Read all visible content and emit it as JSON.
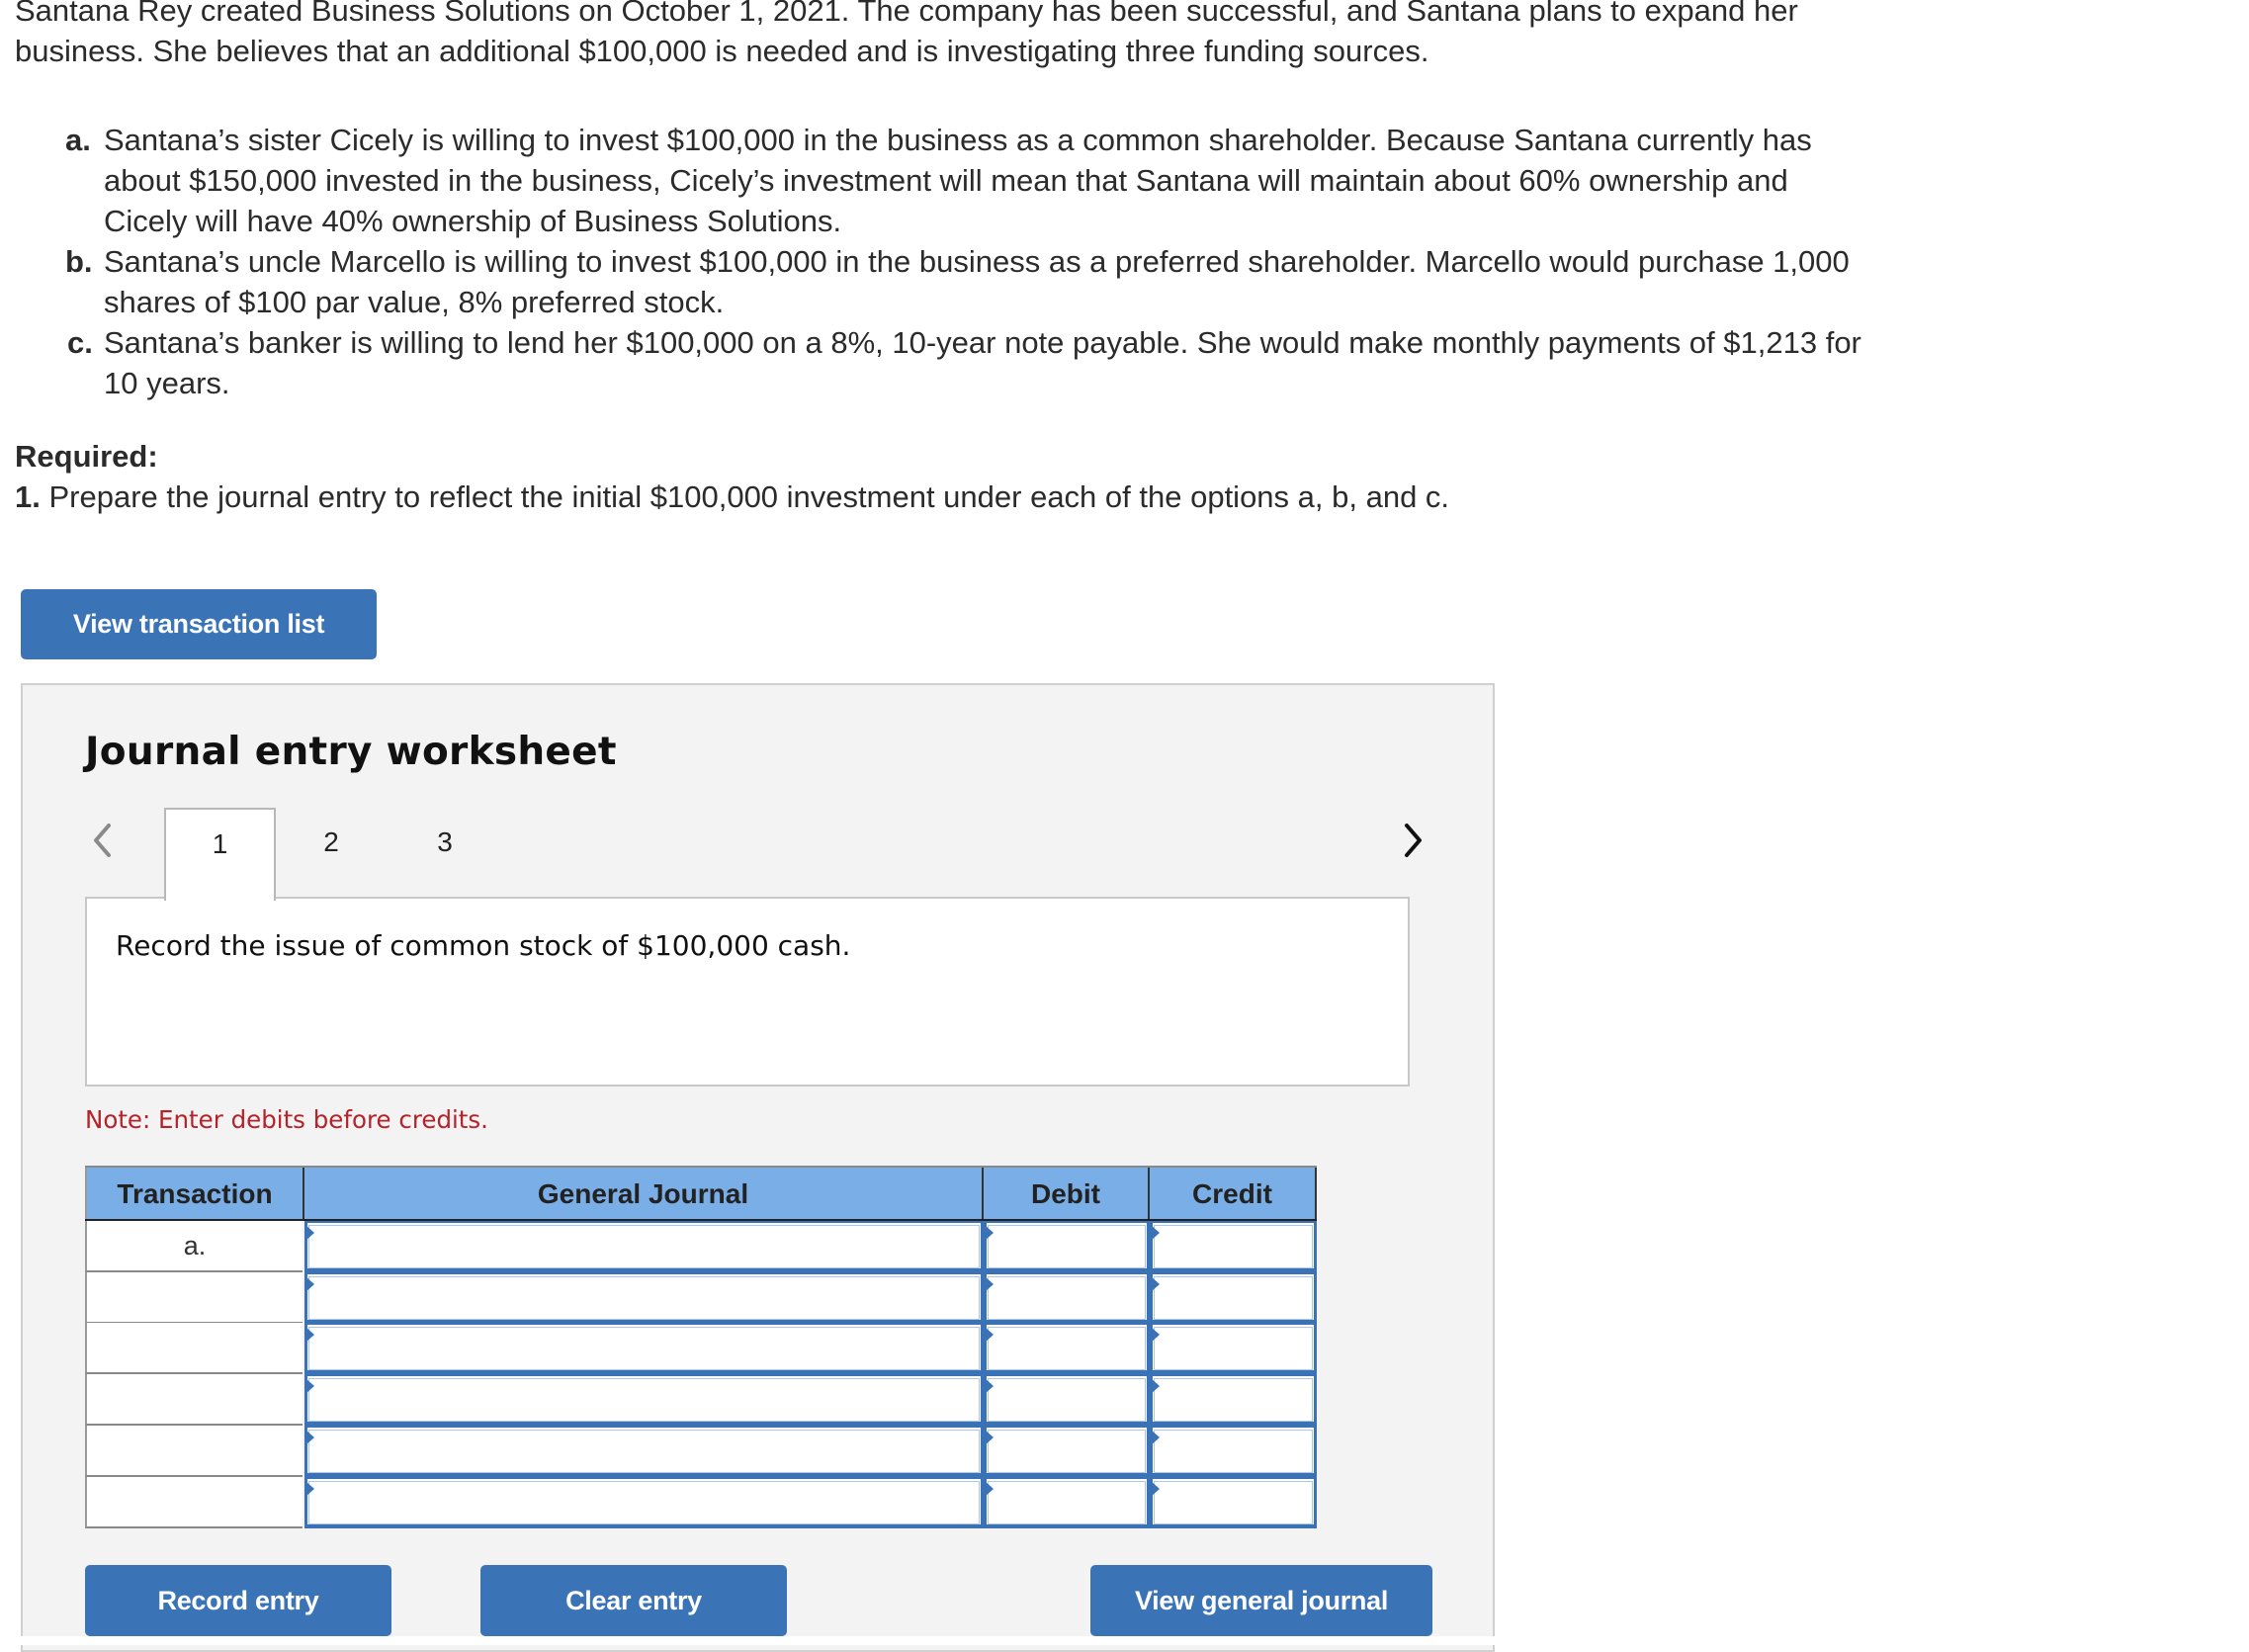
{
  "problem": {
    "intro_lines": [
      "Santana Rey created Business Solutions on October 1, 2021. The company has been successful, and Santana plans to expand her",
      "business. She believes that an additional $100,000 is needed and is investigating three funding sources."
    ],
    "options": [
      {
        "letter": "a.",
        "lines": [
          "Santana’s sister Cicely is willing to invest $100,000 in the business as a common shareholder. Because Santana currently has",
          "about $150,000 invested in the business, Cicely’s investment will mean that Santana will maintain about 60% ownership and",
          "Cicely will have 40% ownership of Business Solutions."
        ]
      },
      {
        "letter": "b.",
        "lines": [
          "Santana’s uncle Marcello is willing to invest $100,000 in the business as a preferred shareholder. Marcello would purchase 1,000",
          "shares of $100 par value, 8% preferred stock."
        ]
      },
      {
        "letter": "c.",
        "lines": [
          "Santana’s banker is willing to lend her $100,000 on a 8%, 10-year note payable. She would make monthly payments of $1,213 for",
          "10 years."
        ]
      }
    ],
    "required_title": "Required:",
    "required_number": "1.",
    "required_text": "Prepare the journal entry to reflect the initial $100,000 investment under each of the options a, b, and c."
  },
  "view_transaction_list_label": "View transaction list",
  "worksheet": {
    "title": "Journal entry worksheet",
    "prev_icon": "chevron-left-icon",
    "next_icon": "chevron-right-icon",
    "tabs": [
      {
        "label": "1",
        "active": true
      },
      {
        "label": "2",
        "active": false
      },
      {
        "label": "3",
        "active": false
      }
    ],
    "description": "Record the issue of common stock of $100,000 cash.",
    "note": "Note: Enter debits before credits.",
    "table": {
      "headers": [
        "Transaction",
        "General Journal",
        "Debit",
        "Credit"
      ],
      "rows": [
        {
          "transaction": "a.",
          "general_journal": "",
          "debit": "",
          "credit": ""
        },
        {
          "transaction": "",
          "general_journal": "",
          "debit": "",
          "credit": ""
        },
        {
          "transaction": "",
          "general_journal": "",
          "debit": "",
          "credit": ""
        },
        {
          "transaction": "",
          "general_journal": "",
          "debit": "",
          "credit": ""
        },
        {
          "transaction": "",
          "general_journal": "",
          "debit": "",
          "credit": ""
        },
        {
          "transaction": "",
          "general_journal": "",
          "debit": "",
          "credit": ""
        }
      ]
    },
    "buttons": {
      "record": "Record entry",
      "clear": "Clear entry",
      "view_general_journal": "View general journal"
    }
  },
  "colors": {
    "button_blue": "#3a74b7",
    "header_blue": "#7aaee6",
    "note_red": "#b5222a",
    "panel_bg": "#f3f3f3"
  }
}
